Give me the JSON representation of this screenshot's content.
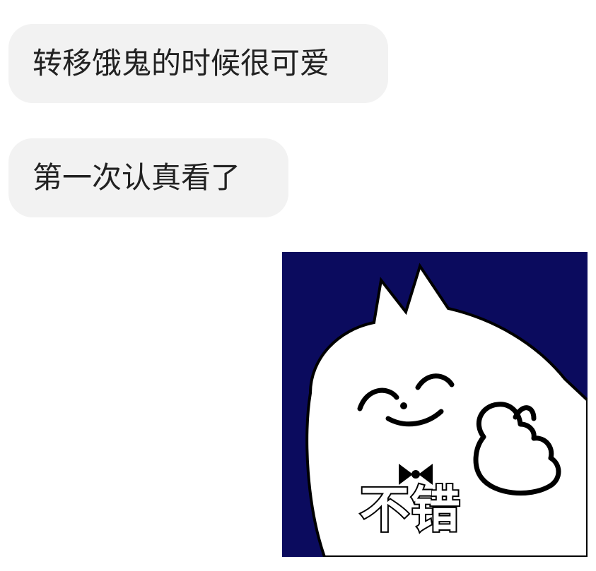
{
  "messages": [
    {
      "text": "转移饿鬼的时候很可爱"
    },
    {
      "text": "第一次认真看了"
    }
  ],
  "sticker": {
    "caption": "不错",
    "description": "white cat thumbs up on navy background",
    "background": "#0b0b5e"
  },
  "colors": {
    "bubble_bg": "#f2f2f2",
    "bubble_text": "#222222",
    "page_bg": "#ffffff"
  }
}
